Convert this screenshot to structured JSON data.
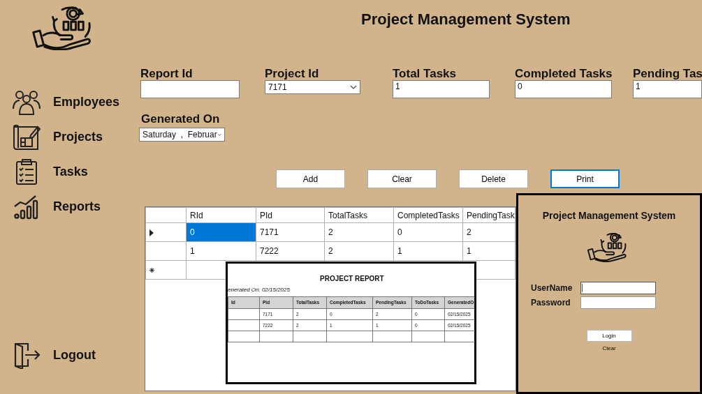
{
  "app": {
    "title": "Project Management System"
  },
  "sidebar": {
    "items": [
      {
        "label": "Employees",
        "kind": "people"
      },
      {
        "label": "Projects",
        "kind": "blueprint"
      },
      {
        "label": "Tasks",
        "kind": "clipboard"
      },
      {
        "label": "Reports",
        "kind": "chart"
      }
    ],
    "logout": {
      "label": "Logout"
    }
  },
  "form": {
    "fields": [
      {
        "label": "Report Id",
        "kind": "text"
      },
      {
        "label": "Project Id",
        "kind": "select",
        "value": "7171"
      },
      {
        "label": "Total Tasks",
        "kind": "text",
        "value": "1"
      },
      {
        "label": "Completed Tasks",
        "kind": "text",
        "value": "0"
      },
      {
        "label": "Pending Tas",
        "kind": "text",
        "value": "1"
      }
    ],
    "generated_on": {
      "label": "Generated On",
      "value": "Saturday  ,  Februar"
    }
  },
  "buttons": [
    {
      "label": "Add",
      "focused": false
    },
    {
      "label": "Clear",
      "focused": false
    },
    {
      "label": "Delete",
      "focused": false
    },
    {
      "label": "Print",
      "focused": true
    }
  ],
  "grid": {
    "columns": [
      "RId",
      "PId",
      "TotalTasks",
      "CompletedTasks",
      "PendingTask"
    ],
    "rows": [
      {
        "current": true,
        "cells": [
          {
            "text": "0",
            "selected": true
          },
          {
            "text": "7171",
            "selected": false
          },
          {
            "text": "2",
            "selected": false
          },
          {
            "text": "0",
            "selected": false
          },
          {
            "text": "2",
            "selected": false
          }
        ]
      },
      {
        "current": false,
        "cells": [
          {
            "text": "1",
            "selected": false
          },
          {
            "text": "7222",
            "selected": false
          },
          {
            "text": "2",
            "selected": false
          },
          {
            "text": "1",
            "selected": false
          },
          {
            "text": "1",
            "selected": false
          }
        ]
      }
    ]
  },
  "report_preview": {
    "title": "PROJECT REPORT",
    "generated": "enerated On: 02/15/2025",
    "columns": [
      "Id",
      "Pid",
      "TotalTasks",
      "CompletedTasks",
      "PendingTasks",
      "ToDoTasks",
      "GeneratedO"
    ],
    "rows": [
      [
        "",
        "7171",
        "2",
        "0",
        "2",
        "0",
        "02/15/2025"
      ],
      [
        "",
        "7222",
        "2",
        "1",
        "1",
        "0",
        "02/15/2025"
      ]
    ]
  },
  "login": {
    "title": "Project Management System",
    "fields": [
      {
        "label": "UserName",
        "focused": true
      },
      {
        "label": "Password",
        "focused": false
      }
    ],
    "login_button": "Login",
    "clear_button": "Clear"
  }
}
